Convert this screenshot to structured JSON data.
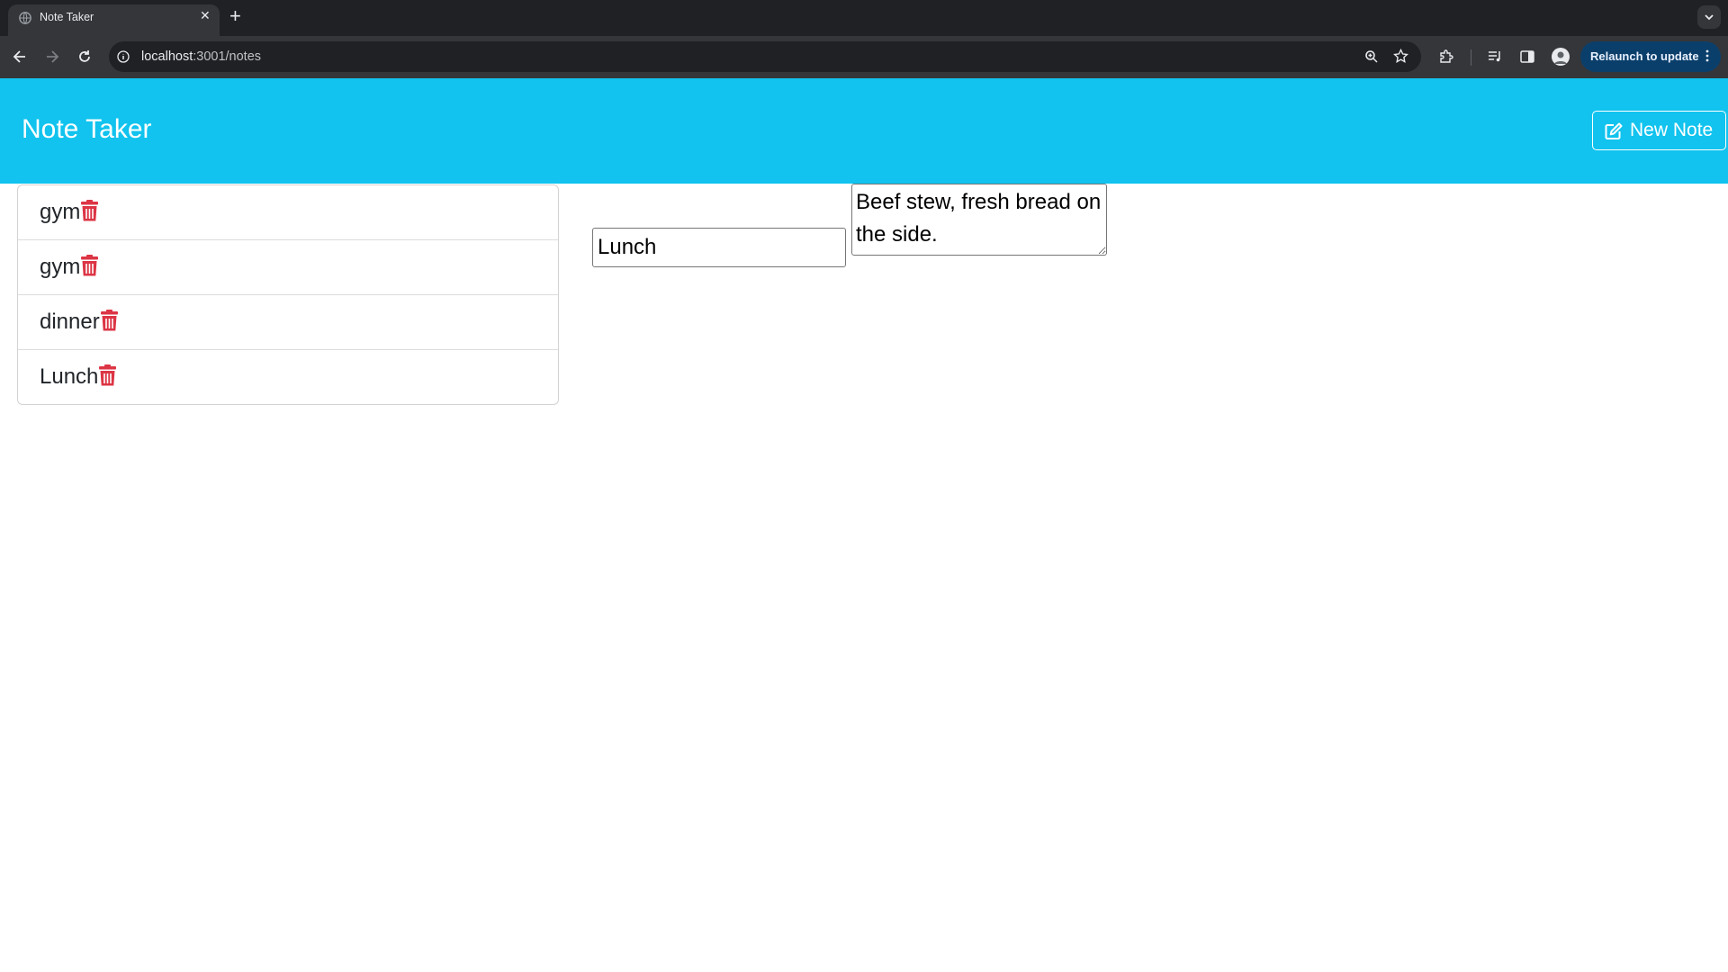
{
  "browser": {
    "tab_title": "Note Taker",
    "url_host": "localhost",
    "url_path": ":3001/notes",
    "relaunch_label": "Relaunch to update"
  },
  "app": {
    "brand": "Note Taker",
    "new_note_label": "New Note",
    "colors": {
      "navbar": "#11c3ee",
      "trash": "#dc3545"
    }
  },
  "notes": [
    {
      "title": "gym"
    },
    {
      "title": "gym"
    },
    {
      "title": "dinner"
    },
    {
      "title": "Lunch"
    }
  ],
  "editor": {
    "title_value": "Lunch",
    "text_value": "Beef stew, fresh bread on the side."
  }
}
